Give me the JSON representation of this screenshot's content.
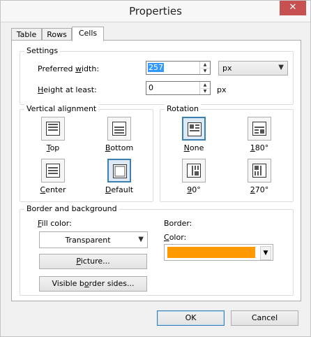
{
  "window": {
    "title": "Properties",
    "close_glyph": "✕"
  },
  "tabs": [
    {
      "label": "Table",
      "active": false
    },
    {
      "label": "Rows",
      "active": false
    },
    {
      "label": "Cells",
      "active": true
    }
  ],
  "settings": {
    "title": "Settings",
    "preferred_width": {
      "label_pre": "Preferred ",
      "label_u": "w",
      "label_post": "idth:",
      "value": "257",
      "unit": "px"
    },
    "height": {
      "label_u": "H",
      "label_post": "eight at least:",
      "value": "0",
      "unit": "px"
    }
  },
  "vertical_alignment": {
    "title": "Vertical alignment",
    "options": [
      {
        "u": "T",
        "rest": "op",
        "selected": false
      },
      {
        "u": "B",
        "rest": "ottom",
        "selected": false
      },
      {
        "u": "C",
        "rest": "enter",
        "selected": false
      },
      {
        "u": "D",
        "rest": "efault",
        "selected": true
      }
    ]
  },
  "rotation": {
    "title": "Rotation",
    "options": [
      {
        "u": "N",
        "rest": "one",
        "selected": true
      },
      {
        "u": "1",
        "rest": "80°",
        "selected": false
      },
      {
        "u": "9",
        "rest": "0°",
        "selected": false
      },
      {
        "u": "2",
        "rest": "70°",
        "selected": false
      }
    ]
  },
  "border_background": {
    "title": "Border and background",
    "fill_color": {
      "label_u": "F",
      "label_post": "ill color:",
      "value": "Transparent"
    },
    "picture_button": {
      "u": "P",
      "rest": "icture..."
    },
    "visible_sides_button": {
      "pre": "Visible b",
      "u": "o",
      "rest": "rder sides..."
    },
    "border_label": "Border:",
    "color": {
      "label_u": "C",
      "label_post": "olor:",
      "value": "#ff9900"
    }
  },
  "footer": {
    "ok": "OK",
    "cancel": "Cancel"
  },
  "colors": {
    "accent": "#3c7fb1",
    "border_color": "#ff9900",
    "close": "#c75050",
    "selection": "#3399ff"
  }
}
